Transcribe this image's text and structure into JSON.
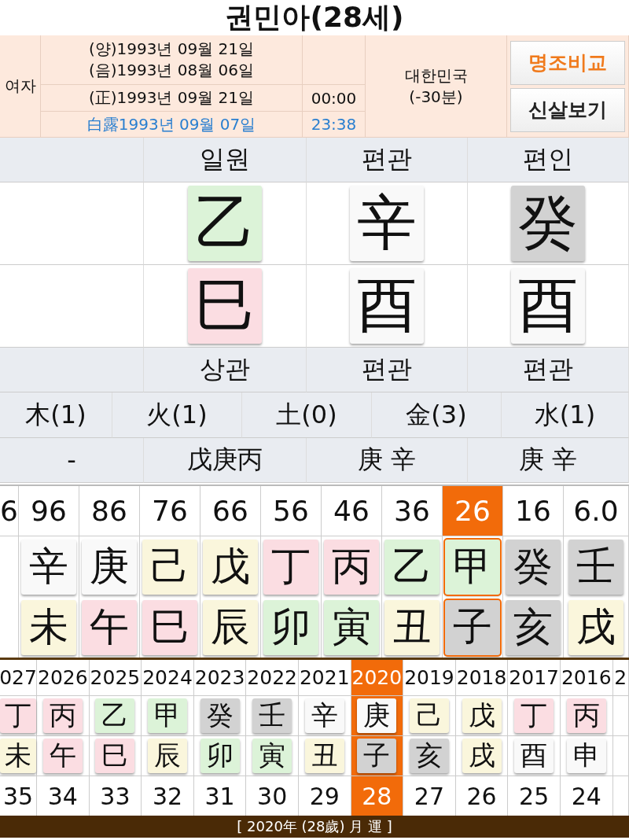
{
  "title": "권민아(28세)",
  "profile": {
    "gender": "여자",
    "solar_date": "(양)1993년 09월 21일",
    "lunar_date": "(음)1993년 08월 06일",
    "corrected_date": "(正)1993년 09월 21일",
    "corrected_time": "00:00",
    "solar_term_date": "白露1993년 09월 07일",
    "solar_term_time": "23:38",
    "country": "대한민국",
    "offset": "(-30분)"
  },
  "buttons": [
    {
      "label": "명조비교",
      "kind": "accent"
    },
    {
      "label": "신살보기",
      "kind": "plain"
    }
  ],
  "pillars": {
    "headers": [
      "일원",
      "편관",
      "편인"
    ],
    "stems": [
      {
        "char": "乙",
        "color": "#dcf3d8"
      },
      {
        "char": "辛",
        "color": "#f9f9f9"
      },
      {
        "char": "癸",
        "color": "#d2d2d2"
      }
    ],
    "branches": [
      {
        "char": "巳",
        "color": "#fbdde2"
      },
      {
        "char": "酉",
        "color": "#f9f9f9"
      },
      {
        "char": "酉",
        "color": "#f9f9f9"
      }
    ],
    "branch_gods": [
      "상관",
      "편관",
      "편관"
    ]
  },
  "five_elements": [
    "木(1)",
    "火(1)",
    "土(0)",
    "金(3)",
    "水(1)"
  ],
  "hidden_stems": [
    "-",
    "戊庚丙",
    "庚 辛",
    "庚 辛"
  ],
  "daewoon": [
    {
      "age": "6",
      "selected": false
    },
    {
      "age": "96",
      "selected": false,
      "stem": {
        "char": "辛",
        "color": "#f9f9f9"
      },
      "branch": {
        "char": "未",
        "color": "#faf6dc"
      }
    },
    {
      "age": "86",
      "selected": false,
      "stem": {
        "char": "庚",
        "color": "#f9f9f9"
      },
      "branch": {
        "char": "午",
        "color": "#fbdde2"
      }
    },
    {
      "age": "76",
      "selected": false,
      "stem": {
        "char": "己",
        "color": "#faf6dc"
      },
      "branch": {
        "char": "巳",
        "color": "#fbdde2"
      }
    },
    {
      "age": "66",
      "selected": false,
      "stem": {
        "char": "戊",
        "color": "#faf6dc"
      },
      "branch": {
        "char": "辰",
        "color": "#faf6dc"
      }
    },
    {
      "age": "56",
      "selected": false,
      "stem": {
        "char": "丁",
        "color": "#fbdde2"
      },
      "branch": {
        "char": "卯",
        "color": "#dcf3d8"
      }
    },
    {
      "age": "46",
      "selected": false,
      "stem": {
        "char": "丙",
        "color": "#fbdde2"
      },
      "branch": {
        "char": "寅",
        "color": "#dcf3d8"
      }
    },
    {
      "age": "36",
      "selected": false,
      "stem": {
        "char": "乙",
        "color": "#dcf3d8"
      },
      "branch": {
        "char": "丑",
        "color": "#faf6dc"
      }
    },
    {
      "age": "26",
      "selected": true,
      "stem": {
        "char": "甲",
        "color": "#dcf3d8"
      },
      "branch": {
        "char": "子",
        "color": "#d2d2d2"
      }
    },
    {
      "age": "16",
      "selected": false,
      "stem": {
        "char": "癸",
        "color": "#d2d2d2"
      },
      "branch": {
        "char": "亥",
        "color": "#d2d2d2"
      }
    },
    {
      "age": "6.0",
      "selected": false,
      "stem": {
        "char": "壬",
        "color": "#d2d2d2"
      },
      "branch": {
        "char": "戌",
        "color": "#faf6dc"
      }
    }
  ],
  "years": [
    {
      "year": "027",
      "selected": false,
      "stem": {
        "char": "丁",
        "color": "#fbdde2"
      },
      "branch": {
        "char": "未",
        "color": "#faf6dc"
      },
      "age": "35"
    },
    {
      "year": "2026",
      "selected": false,
      "stem": {
        "char": "丙",
        "color": "#fbdde2"
      },
      "branch": {
        "char": "午",
        "color": "#fbdde2"
      },
      "age": "34"
    },
    {
      "year": "2025",
      "selected": false,
      "stem": {
        "char": "乙",
        "color": "#dcf3d8"
      },
      "branch": {
        "char": "巳",
        "color": "#fbdde2"
      },
      "age": "33"
    },
    {
      "year": "2024",
      "selected": false,
      "stem": {
        "char": "甲",
        "color": "#dcf3d8"
      },
      "branch": {
        "char": "辰",
        "color": "#faf6dc"
      },
      "age": "32"
    },
    {
      "year": "2023",
      "selected": false,
      "stem": {
        "char": "癸",
        "color": "#d2d2d2"
      },
      "branch": {
        "char": "卯",
        "color": "#dcf3d8"
      },
      "age": "31"
    },
    {
      "year": "2022",
      "selected": false,
      "stem": {
        "char": "壬",
        "color": "#d2d2d2"
      },
      "branch": {
        "char": "寅",
        "color": "#dcf3d8"
      },
      "age": "30"
    },
    {
      "year": "2021",
      "selected": false,
      "stem": {
        "char": "辛",
        "color": "#f9f9f9"
      },
      "branch": {
        "char": "丑",
        "color": "#faf6dc"
      },
      "age": "29"
    },
    {
      "year": "2020",
      "selected": true,
      "stem": {
        "char": "庚",
        "color": "#f9f9f9"
      },
      "branch": {
        "char": "子",
        "color": "#d2d2d2"
      },
      "age": "28"
    },
    {
      "year": "2019",
      "selected": false,
      "stem": {
        "char": "己",
        "color": "#faf6dc"
      },
      "branch": {
        "char": "亥",
        "color": "#d2d2d2"
      },
      "age": "27"
    },
    {
      "year": "2018",
      "selected": false,
      "stem": {
        "char": "戊",
        "color": "#faf6dc"
      },
      "branch": {
        "char": "戌",
        "color": "#faf6dc"
      },
      "age": "26"
    },
    {
      "year": "2017",
      "selected": false,
      "stem": {
        "char": "丁",
        "color": "#fbdde2"
      },
      "branch": {
        "char": "酉",
        "color": "#f9f9f9"
      },
      "age": "25"
    },
    {
      "year": "2016",
      "selected": false,
      "stem": {
        "char": "丙",
        "color": "#fbdde2"
      },
      "branch": {
        "char": "申",
        "color": "#f9f9f9"
      },
      "age": "24"
    },
    {
      "year": "2",
      "selected": false
    }
  ],
  "month_bar": "[ 2020年 (28歲) 月 運 ]"
}
